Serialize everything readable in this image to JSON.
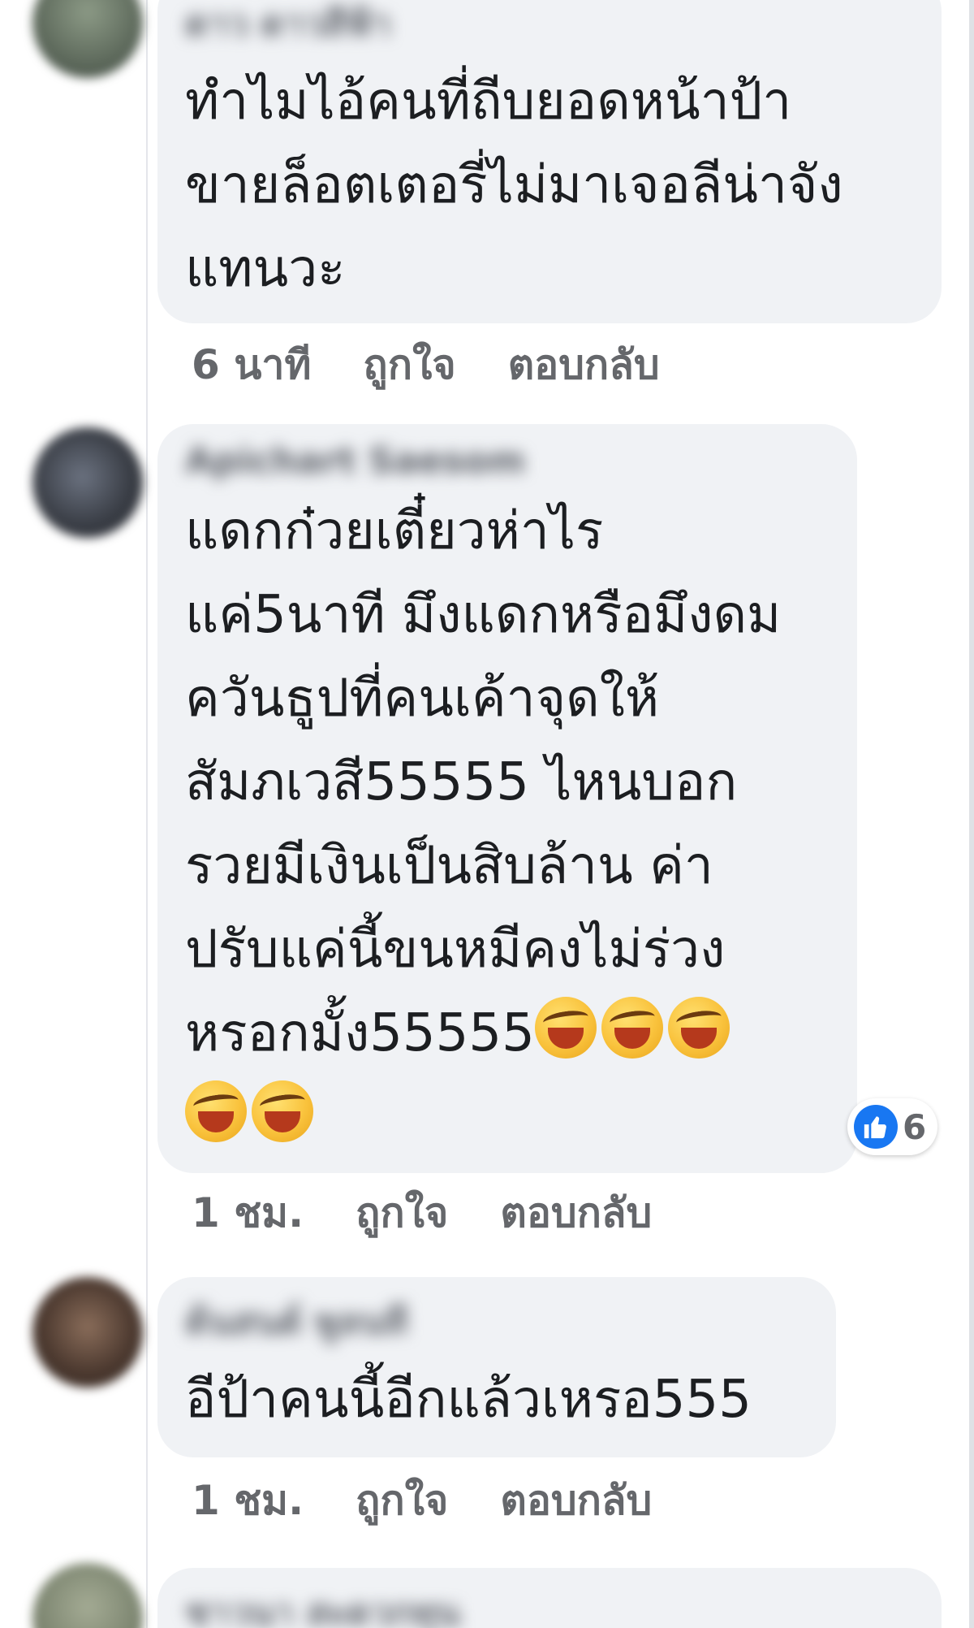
{
  "colors": {
    "bubble": "#f0f2f5",
    "text": "#1c1e21",
    "meta": "#65676b",
    "like": "#1877f2"
  },
  "comments": [
    {
      "author": "ดาว ดาวสีฟ้า",
      "lines": [
        "ทำไมไอ้คนที่ถีบยอดหน้าป้า",
        "ขายล็อตเตอรี่ไม่มาเจอลีน่าจัง",
        "แทนวะ"
      ],
      "time": "6 นาที",
      "like_label": "ถูกใจ",
      "reply_label": "ตอบกลับ"
    },
    {
      "author": "Apichart Saesom",
      "lines": [
        "แดกก๋วยเตี๋ยวห่าไร",
        "แค่5นาที มึงแดกหรือมึงดม",
        "ควันธูปที่คนเค้าจุดให้",
        "สัมภเวสี55555 ไหนบอก",
        "รวยมีเงินเป็นสิบล้าน ค่า",
        "ปรับแค่นี้ขนหมีคงไม่ร่วง",
        "หรอกมั้ง55555"
      ],
      "emoji_name": "rolling-on-floor-laughing",
      "emoji_count": 5,
      "reaction_count": "6",
      "time": "1 ชม.",
      "like_label": "ถูกใจ",
      "reply_label": "ตอบกลับ"
    },
    {
      "author": "ต้นสนต์ พูลนที",
      "lines": [
        "อีป้าคนนี้อีกแล้วเหรอ555"
      ],
      "time": "1 ชม.",
      "like_label": "ถูกใจ",
      "reply_label": "ตอบกลับ"
    },
    {
      "author": "ชาวนา สะดวกทุน"
    }
  ]
}
